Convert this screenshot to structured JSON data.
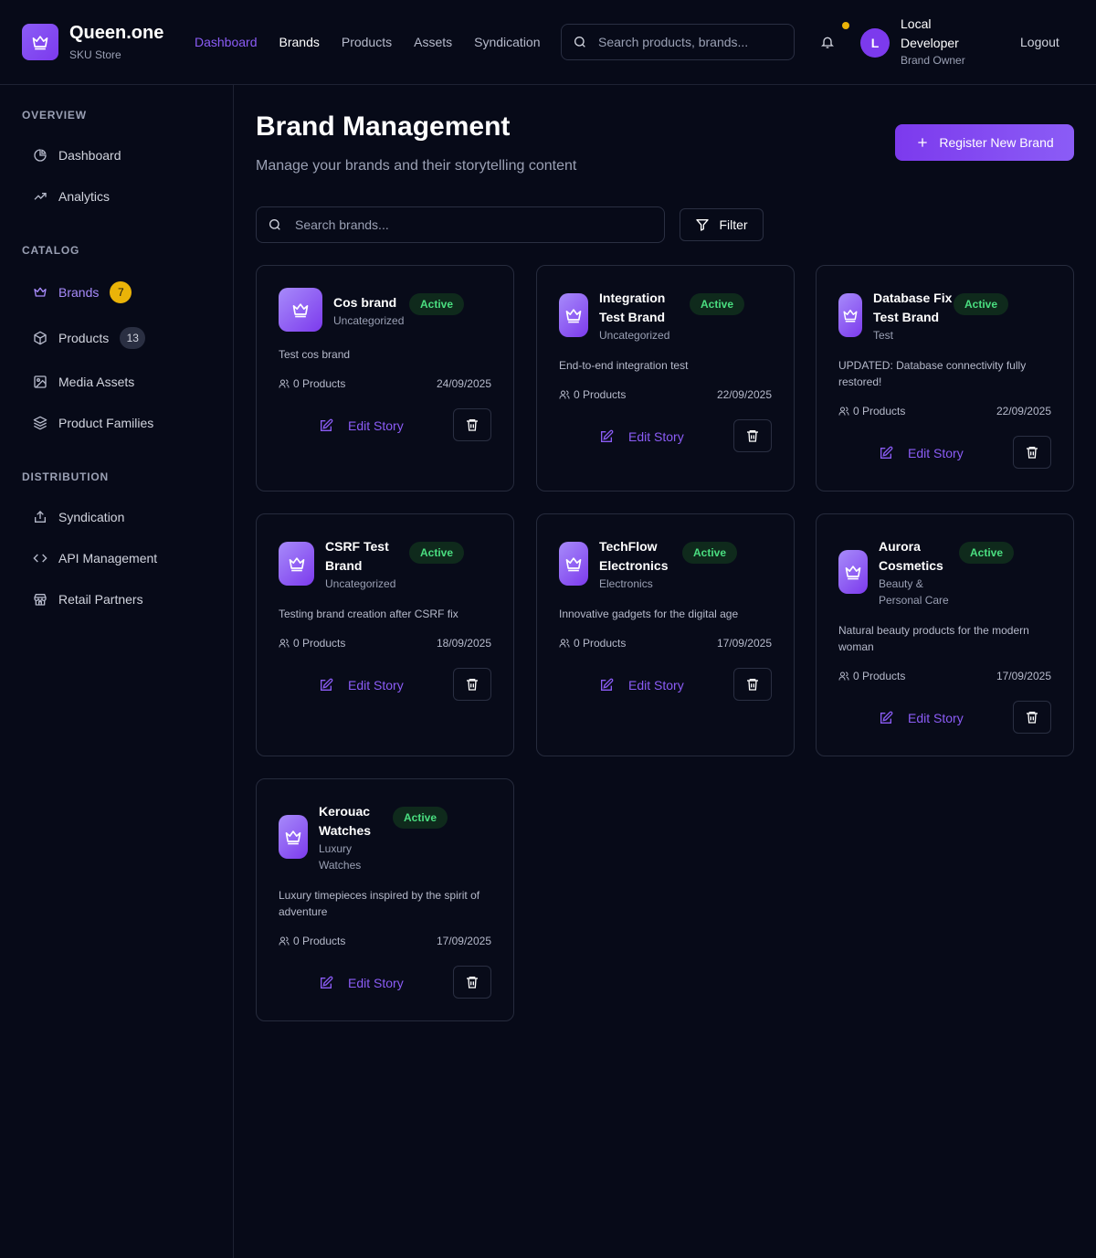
{
  "app": {
    "name": "Queen.one",
    "subtitle": "SKU Store"
  },
  "header": {
    "nav": [
      "Dashboard",
      "Brands",
      "Products",
      "Assets",
      "Syndication"
    ],
    "search_placeholder": "Search products, brands...",
    "user": {
      "initial": "L",
      "name": "Local Developer",
      "role": "Brand Owner"
    },
    "logout_label": "Logout"
  },
  "sidebar": {
    "sections": [
      {
        "title": "OVERVIEW",
        "items": [
          {
            "label": "Dashboard",
            "icon": "pie-chart-icon"
          },
          {
            "label": "Analytics",
            "icon": "trending-up-icon"
          }
        ]
      },
      {
        "title": "CATALOG",
        "items": [
          {
            "label": "Brands",
            "icon": "crown-icon",
            "badge": "7"
          },
          {
            "label": "Products",
            "icon": "package-icon",
            "badge": "13"
          },
          {
            "label": "Media Assets",
            "icon": "image-icon"
          },
          {
            "label": "Product Families",
            "icon": "layers-icon"
          }
        ]
      },
      {
        "title": "DISTRIBUTION",
        "items": [
          {
            "label": "Syndication",
            "icon": "share-icon"
          },
          {
            "label": "API Management",
            "icon": "code-icon"
          },
          {
            "label": "Retail Partners",
            "icon": "store-icon"
          }
        ]
      }
    ]
  },
  "main": {
    "title": "Brand Management",
    "subtitle": "Manage your brands and their storytelling content",
    "register_label": "Register New Brand",
    "search_placeholder": "Search brands...",
    "filter_label": "Filter",
    "edit_label": "Edit Story",
    "brands": [
      {
        "name": "Cos brand",
        "category": "Uncategorized",
        "status": "Active",
        "description": "Test cos brand",
        "products": "0 Products",
        "date": "24/09/2025"
      },
      {
        "name": "Integration Test Brand",
        "category": "Uncategorized",
        "status": "Active",
        "description": "End-to-end integration test",
        "products": "0 Products",
        "date": "22/09/2025"
      },
      {
        "name": "Database Fix Test Brand",
        "category": "Test",
        "status": "Active",
        "description": "UPDATED: Database connectivity fully restored!",
        "products": "0 Products",
        "date": "22/09/2025"
      },
      {
        "name": "CSRF Test Brand",
        "category": "Uncategorized",
        "status": "Active",
        "description": "Testing brand creation after CSRF fix",
        "products": "0 Products",
        "date": "18/09/2025"
      },
      {
        "name": "TechFlow Electronics",
        "category": "Electronics",
        "status": "Active",
        "description": "Innovative gadgets for the digital age",
        "products": "0 Products",
        "date": "17/09/2025"
      },
      {
        "name": "Aurora Cosmetics",
        "category": "Beauty & Personal Care",
        "status": "Active",
        "description": "Natural beauty products for the modern woman",
        "products": "0 Products",
        "date": "17/09/2025"
      },
      {
        "name": "Kerouac Watches",
        "category": "Luxury Watches",
        "status": "Active",
        "description": "Luxury timepieces inspired by the spirit of adventure",
        "products": "0 Products",
        "date": "17/09/2025"
      }
    ]
  },
  "colors": {
    "accent": "#8b5cf6",
    "background": "#070a18",
    "status_active": "#4ade80",
    "badge": "#eab308"
  }
}
